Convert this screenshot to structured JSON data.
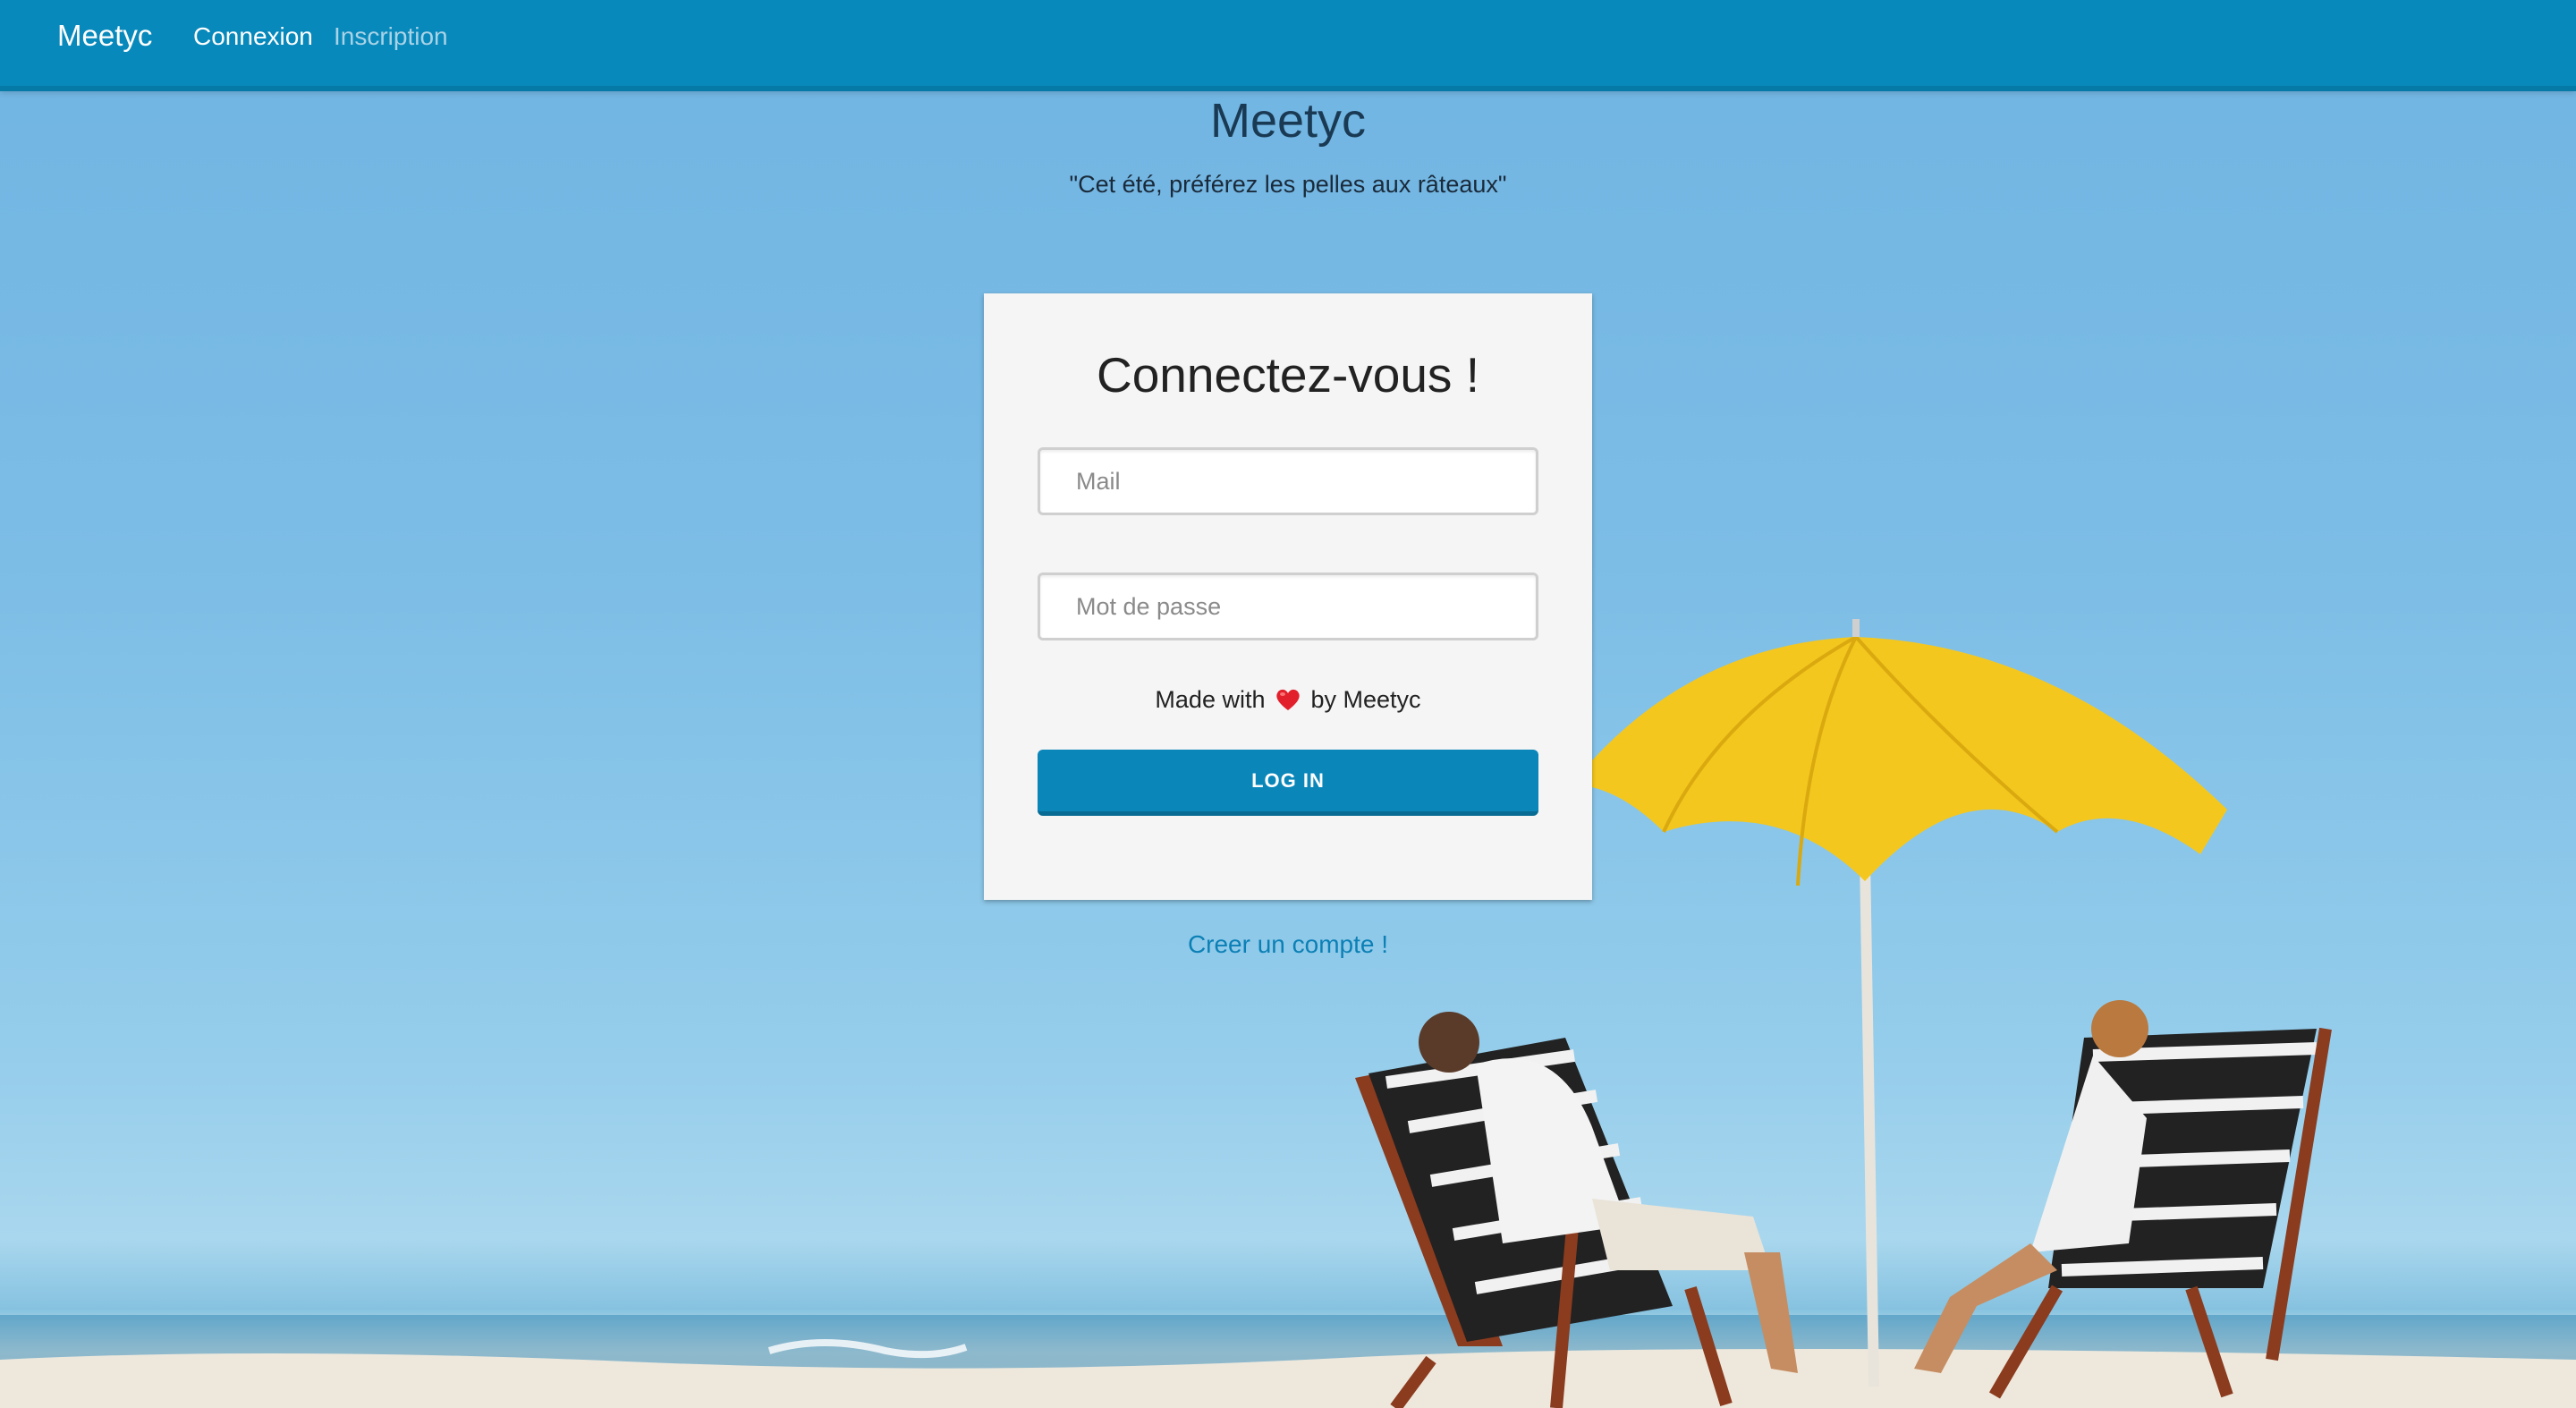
{
  "navbar": {
    "brand": "Meetyc",
    "links": [
      {
        "label": "Connexion",
        "active": true
      },
      {
        "label": "Inscription",
        "active": false
      }
    ]
  },
  "hero": {
    "title": "Meetyc",
    "tagline": "\"Cet été, préférez les pelles aux râteaux\""
  },
  "login_card": {
    "title": "Connectez-vous !",
    "mail_placeholder": "Mail",
    "password_placeholder": "Mot de passe",
    "made_with_prefix": "Made with",
    "made_with_suffix": "by Meetyc",
    "login_button": "LOG IN"
  },
  "create_account_link": "Creer un compte !",
  "icons": {
    "made_with": "heart-icon"
  },
  "colors": {
    "navbar": "#0889bb",
    "primary_button": "#0a86b9",
    "link": "#0c80b5",
    "card_background": "#f5f5f5"
  }
}
